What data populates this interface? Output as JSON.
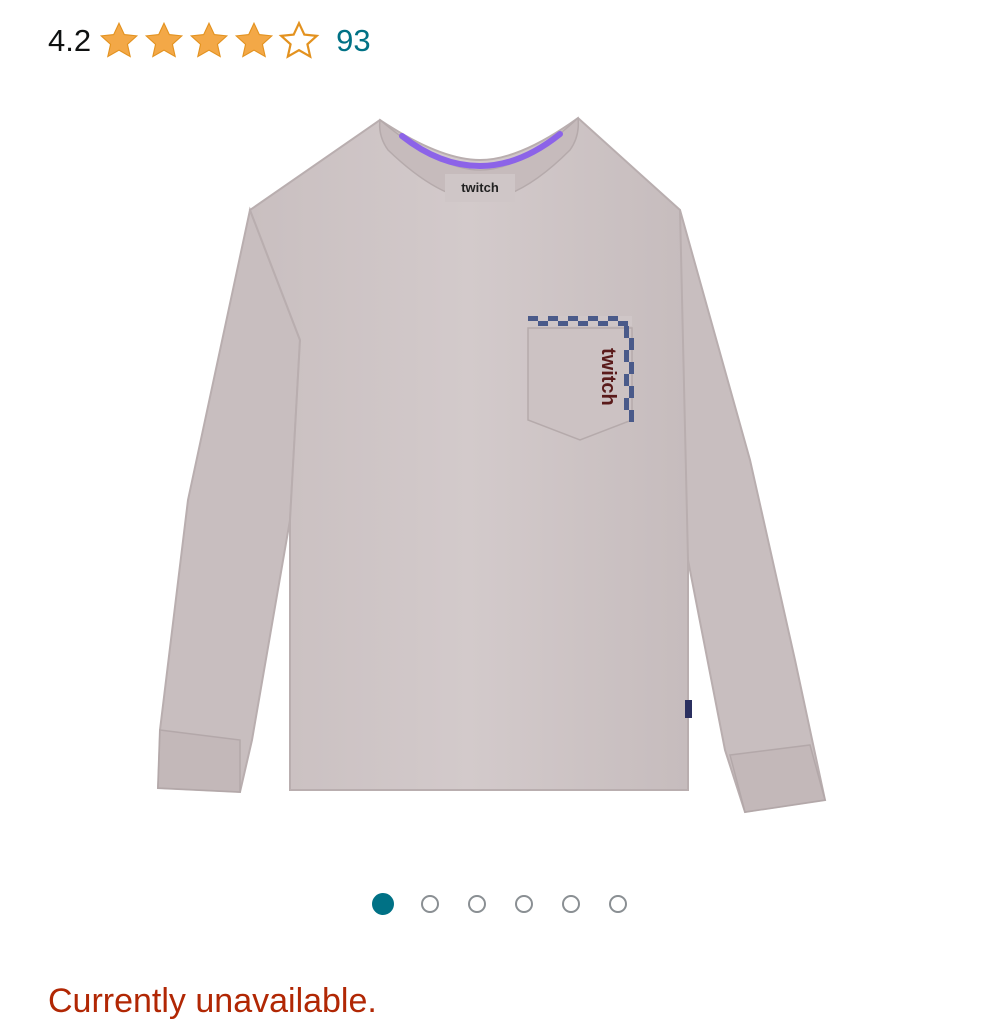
{
  "rating": {
    "value": "4.2",
    "stars_filled": 4,
    "stars_total": 5,
    "review_count": "93",
    "star_color": "#f3a847",
    "link_color": "#007185"
  },
  "product_image": {
    "pocket_brand_text": "twitch",
    "collar_brand_text": "twitch",
    "shirt_color": "#cfc6c7",
    "accent_color": "#8c63e8"
  },
  "carousel": {
    "total": 6,
    "active_index": 0,
    "active_color": "#007185"
  },
  "availability": {
    "text": "Currently unavailable.",
    "color": "#b12704"
  }
}
